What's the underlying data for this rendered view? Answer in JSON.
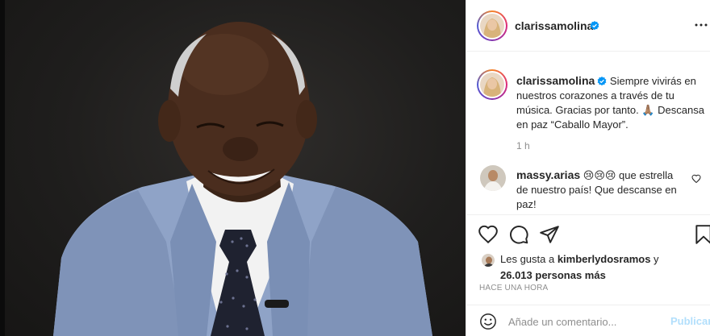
{
  "post": {
    "author": "clarissamolina",
    "verified": true,
    "caption": "Siempre vivirás en nuestros corazones a través de tu música. Gracias por tanto. 🙏🏽 Descansa en paz “Caballo Mayor”.",
    "caption_time": "1 h"
  },
  "comment": {
    "author": "massy.arias",
    "text": "😢😢😢 que estrella de nuestro país! Que descanse en paz!"
  },
  "likes": {
    "prefix": "Les gusta a ",
    "user": "kimberlydosramos",
    "joiner": " y",
    "count_text": "26.013 personas más"
  },
  "timestamp": "HACE UNA HORA",
  "comment_input": {
    "placeholder": "Añade un comentario..."
  },
  "publish_label": "Publicar",
  "colors": {
    "verified_blue": "#0095f6",
    "publish_disabled": "#b2dffc",
    "text_primary": "#262626",
    "text_secondary": "#8e8e8e",
    "suit_blue": "#8fa3c7"
  },
  "icons": [
    "more-icon",
    "verified-icon",
    "heart-icon",
    "comment-icon",
    "share-icon",
    "bookmark-icon",
    "emoji-icon",
    "small-heart-icon"
  ]
}
